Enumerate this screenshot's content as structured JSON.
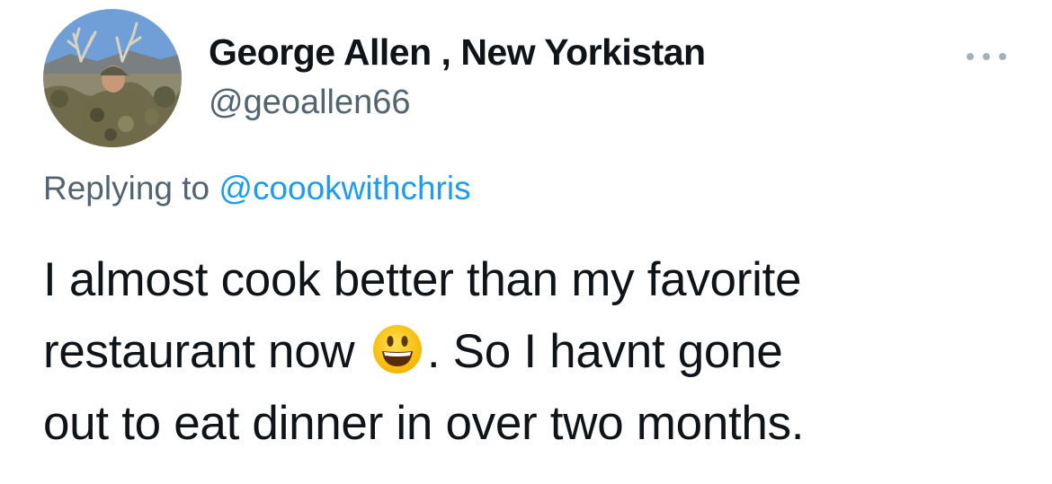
{
  "tweet": {
    "display_name": "George Allen , New Yorkistan",
    "handle": "@geoallen66",
    "replying_prefix": "Replying to",
    "replying_to": "@coookwithchris",
    "text_line1": "I almost cook better than my favorite",
    "text_line2_before": "restaurant now",
    "text_line2_after": ". So I havnt gone",
    "text_line3": "out to eat dinner in over two months.",
    "emoji": "smiley-emoji",
    "more_icon": "more-options-icon"
  },
  "colors": {
    "text": "#0f1419",
    "secondary_text": "#536471",
    "link": "#1d9bf0",
    "background": "#ffffff"
  }
}
